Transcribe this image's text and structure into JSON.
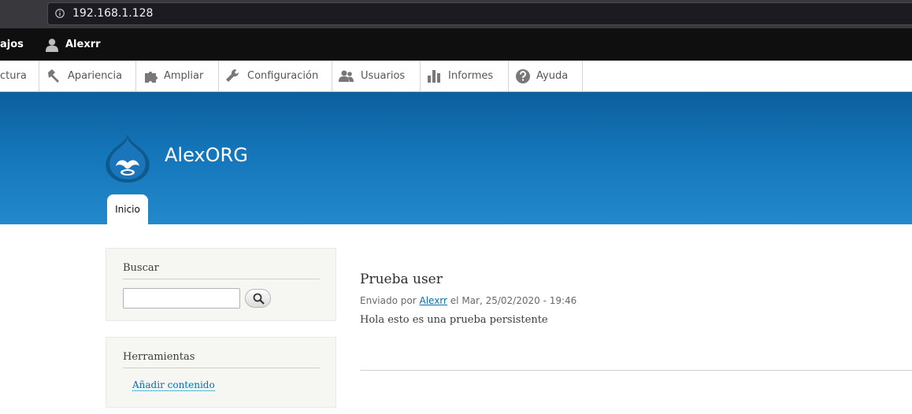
{
  "browser": {
    "url": "192.168.1.128"
  },
  "admin_bar": {
    "left_item": "ajos",
    "user_name": "Alexrr"
  },
  "tray": {
    "items": [
      {
        "label": "ctura",
        "icon": "structure-icon"
      },
      {
        "label": "Apariencia",
        "icon": "appearance-icon"
      },
      {
        "label": "Ampliar",
        "icon": "extend-icon"
      },
      {
        "label": "Configuración",
        "icon": "wrench-icon"
      },
      {
        "label": "Usuarios",
        "icon": "people-icon"
      },
      {
        "label": "Informes",
        "icon": "reports-icon"
      },
      {
        "label": "Ayuda",
        "icon": "help-icon"
      }
    ]
  },
  "header": {
    "site_name": "AlexORG",
    "tab_home": "Inicio"
  },
  "sidebar": {
    "search": {
      "title": "Buscar",
      "value": "",
      "placeholder": ""
    },
    "tools": {
      "title": "Herramientas",
      "link": "Añadir contenido"
    }
  },
  "node": {
    "title": "Prueba user",
    "submitted_prefix": "Enviado por",
    "author": "Alexrr",
    "submitted_suffix": "el Mar, 25/02/2020 - 19:46",
    "body": "Hola esto es una prueba persistente"
  },
  "colors": {
    "header_top": "#0c5f9c",
    "header_bottom": "#2389cc",
    "link": "#0071b3",
    "admin_bar": "#0f0f0f"
  }
}
